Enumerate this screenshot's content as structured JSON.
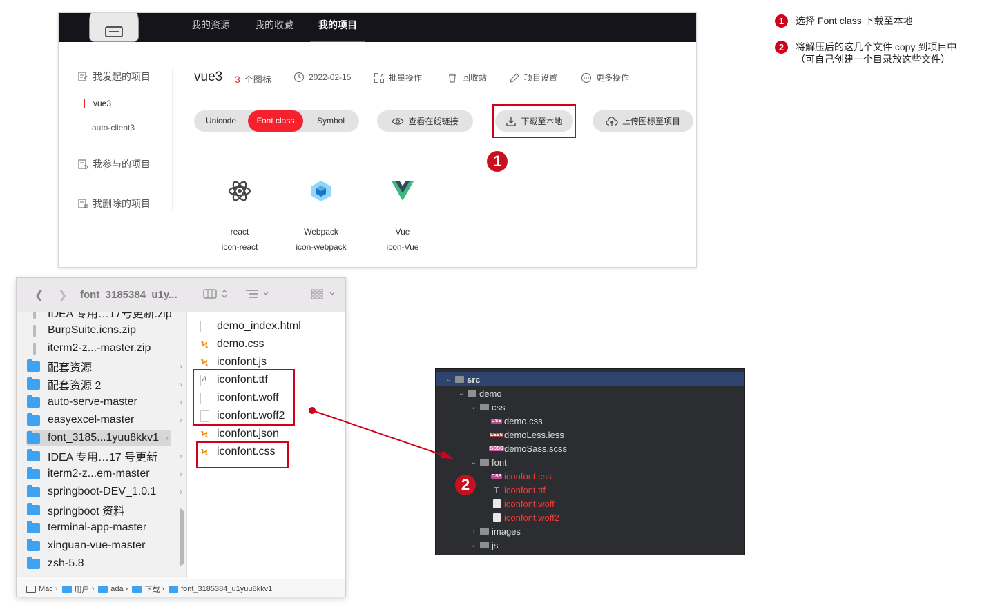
{
  "notes": [
    {
      "num": "1",
      "text": "选择 Font class 下载至本地"
    },
    {
      "num": "2",
      "text": "将解压后的这几个文件 copy 到项目中（可自己创建一个目录放这些文件）"
    }
  ],
  "iconfont": {
    "topnav": [
      "我的资源",
      "我的收藏",
      "我的项目"
    ],
    "active_topnav": "我的项目",
    "sidebar": {
      "heading1": "我发起的项目",
      "items": [
        "vue3",
        "auto-client3"
      ],
      "heading2": "我参与的项目",
      "heading3": "我删除的项目"
    },
    "project": {
      "name": "vue3",
      "count": "3",
      "count_unit": "个图标"
    },
    "tools": {
      "date": "2022-02-15",
      "batch": "批量操作",
      "trash": "回收站",
      "settings": "项目设置",
      "more": "更多操作"
    },
    "tabs": [
      "Unicode",
      "Font class",
      "Symbol"
    ],
    "active_tab": "Font class",
    "buttons": {
      "view_link": "查看在线链接",
      "download": "下载至本地",
      "upload": "上传图标至项目"
    },
    "badge1": "1",
    "icons": [
      {
        "name": "react",
        "code": "icon-react"
      },
      {
        "name": "Webpack",
        "code": "icon-webpack"
      },
      {
        "name": "Vue",
        "code": "icon-Vue"
      }
    ]
  },
  "finder": {
    "title": "font_3185384_u1y...",
    "sidebar_cut": "IDEA 专用…17号更新.zip",
    "sidebar": [
      {
        "label": "BurpSuite.icns.zip",
        "kind": "zip"
      },
      {
        "label": "iterm2-z...-master.zip",
        "kind": "zip"
      },
      {
        "label": "配套资源",
        "kind": "folder"
      },
      {
        "label": "配套资源 2",
        "kind": "folder"
      },
      {
        "label": "auto-serve-master",
        "kind": "folder"
      },
      {
        "label": "easyexcel-master",
        "kind": "folder"
      },
      {
        "label": "font_3185...1yuu8kkv1",
        "kind": "folder",
        "selected": true
      },
      {
        "label": "IDEA 专用…17 号更新",
        "kind": "folder"
      },
      {
        "label": "iterm2-z...em-master",
        "kind": "folder"
      },
      {
        "label": "springboot-DEV_1.0.1",
        "kind": "folder"
      },
      {
        "label": "springboot 资料",
        "kind": "folder"
      },
      {
        "label": "terminal-app-master",
        "kind": "folder"
      },
      {
        "label": "xinguan-vue-master",
        "kind": "folder"
      },
      {
        "label": "zsh-5.8",
        "kind": "folder"
      }
    ],
    "files": [
      {
        "label": "demo_index.html",
        "kind": "html"
      },
      {
        "label": "demo.css",
        "kind": "sublime"
      },
      {
        "label": "iconfont.js",
        "kind": "sublime"
      },
      {
        "label": "iconfont.ttf",
        "kind": "font"
      },
      {
        "label": "iconfont.woff",
        "kind": "doc"
      },
      {
        "label": "iconfont.woff2",
        "kind": "doc"
      },
      {
        "label": "iconfont.json",
        "kind": "sublime"
      },
      {
        "label": "iconfont.css",
        "kind": "sublime"
      }
    ],
    "path": [
      "Mac",
      "用户",
      "ada",
      "下载",
      "font_3185384_u1yuu8kkv1"
    ]
  },
  "ide": {
    "badge2": "2",
    "tree": [
      {
        "label": "src",
        "kind": "folder",
        "open": true,
        "level": 0,
        "selected": true
      },
      {
        "label": "demo",
        "kind": "folder",
        "open": true,
        "level": 1
      },
      {
        "label": "css",
        "kind": "folder",
        "open": true,
        "level": 2
      },
      {
        "label": "demo.css",
        "kind": "css",
        "level": 3
      },
      {
        "label": "demoLess.less",
        "kind": "less",
        "level": 3
      },
      {
        "label": "demoSass.scss",
        "kind": "scss",
        "level": 3
      },
      {
        "label": "font",
        "kind": "folder",
        "open": true,
        "level": 2
      },
      {
        "label": "iconfont.css",
        "kind": "css",
        "level": 3,
        "red": true
      },
      {
        "label": "iconfont.ttf",
        "kind": "ttf",
        "level": 3,
        "red": true
      },
      {
        "label": "iconfont.woff",
        "kind": "file",
        "level": 3,
        "red": true
      },
      {
        "label": "iconfont.woff2",
        "kind": "file",
        "level": 3,
        "red": true
      },
      {
        "label": "images",
        "kind": "folder",
        "open": false,
        "level": 2
      },
      {
        "label": "js",
        "kind": "folder",
        "open": true,
        "level": 2
      }
    ]
  },
  "colors": {
    "accent": "#f5222d",
    "annotation": "#d0021b",
    "folder": "#3ea2f2"
  }
}
